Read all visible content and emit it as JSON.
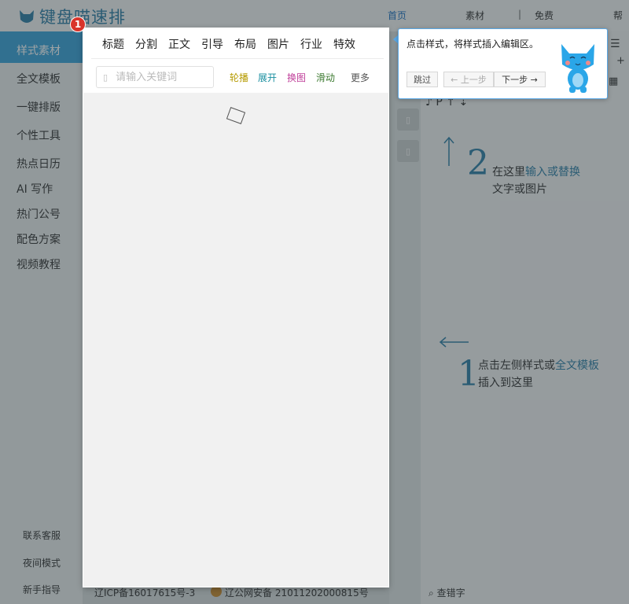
{
  "app": {
    "logo_text": "键盘喵速排"
  },
  "topnav": {
    "home": "首页",
    "material": "素材",
    "free": "免费",
    "help": "帮"
  },
  "sidebar": {
    "items": [
      "样式素材",
      "全文模板",
      "一键排版",
      "个性工具",
      "热点日历",
      "AI 写作",
      "热门公号",
      "配色方案",
      "视频教程"
    ],
    "bottom": [
      "联系客服",
      "夜间模式",
      "新手指导"
    ]
  },
  "panel": {
    "tabs": [
      "标题",
      "分割",
      "正文",
      "引导",
      "布局",
      "图片",
      "行业",
      "特效"
    ],
    "search_placeholder": "请输入关键词",
    "filters": [
      {
        "label": "轮播",
        "color": "#b59a00"
      },
      {
        "label": "展开",
        "color": "#1a8fa0"
      },
      {
        "label": "换图",
        "color": "#c0409a"
      },
      {
        "label": "滑动",
        "color": "#3c7a30"
      }
    ],
    "more": "更多"
  },
  "tour": {
    "step": "1",
    "text": "点击样式，将样式插入编辑区。",
    "skip": "跳过",
    "prev": "← 上一步",
    "next": "下一步 →"
  },
  "hints": {
    "step2_number": "2",
    "step2_line1_prefix": "在这里",
    "step2_line1_highlight": "输入或替换",
    "step2_line2": "文字或图片",
    "step1_number": "1",
    "step1_line1_prefix": "点击左侧样式或",
    "step1_line1_highlight": "全文模板",
    "step1_line2": "插入到这里"
  },
  "footer": {
    "icp": "辽ICP备16017615号-3",
    "police": "辽公网安备 21011202000815号",
    "typo_check": "查错字"
  },
  "colors": {
    "accent": "#3aa2d9",
    "badge": "#d9342b",
    "hint": "#2f7fa6"
  }
}
